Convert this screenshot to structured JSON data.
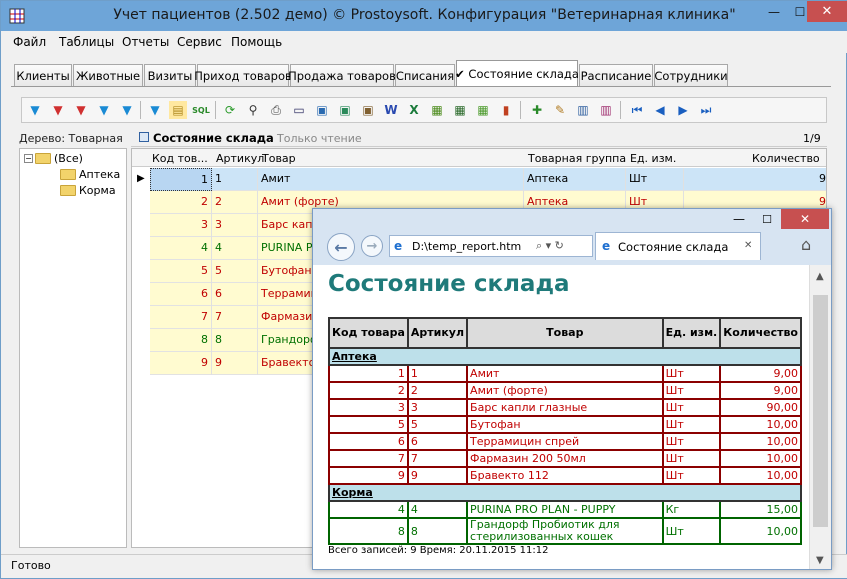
{
  "window": {
    "title": "Учет пациентов (2.502 демо) © Prostoysoft. Конфигурация \"Ветеринарная клиника\"",
    "min_glyph": "—",
    "max_glyph": "☐",
    "close_glyph": "✕"
  },
  "menu": [
    "Файл",
    "Таблицы",
    "Отчеты",
    "Сервис",
    "Помощь"
  ],
  "tabs": [
    {
      "label": "Клиенты"
    },
    {
      "label": "Животные"
    },
    {
      "label": "Визиты"
    },
    {
      "label": "Приход товаров"
    },
    {
      "label": "Продажа товаров"
    },
    {
      "label": "Списания"
    },
    {
      "label": "✔ Состояние склада",
      "active": true
    },
    {
      "label": "Расписание"
    },
    {
      "label": "Сотрудники"
    }
  ],
  "toolbar_icons": [
    "filter-icon",
    "filter-clear-icon",
    "filter-remove-icon",
    "filter-add-icon",
    "filter-edit-icon",
    "filter-view-icon",
    "tree-filter-icon",
    "sql-icon",
    "refresh-icon",
    "binoculars-icon",
    "print-icon",
    "preview-icon",
    "export-html-icon",
    "export-xml-icon",
    "export-doc-icon",
    "export-word-icon",
    "export-excel-icon",
    "export-csv-icon",
    "export-dbf-icon",
    "chart-icon",
    "add-record-icon",
    "edit-record-icon",
    "columns-icon",
    "settings-icon",
    "first-icon",
    "prev-icon",
    "next-icon",
    "last-icon"
  ],
  "tree": {
    "label": "Дерево: Товарная",
    "root": "(Все)",
    "children": [
      "Аптека",
      "Корма"
    ]
  },
  "grid": {
    "title": "Состояние склада",
    "mode": "Только чтение",
    "counter": "1/9",
    "columns": [
      "Код тов...",
      "Артикул",
      "Товар",
      "Товарная группа",
      "Ед. изм.",
      "Количество"
    ],
    "rows": [
      {
        "code": "1",
        "art": "1",
        "name": "Амит",
        "group": "Аптека",
        "unit": "Шт",
        "qty": "9",
        "color": "sel"
      },
      {
        "code": "2",
        "art": "2",
        "name": "Амит (форте)",
        "group": "Аптека",
        "unit": "Шт",
        "qty": "9",
        "color": "red"
      },
      {
        "code": "3",
        "art": "3",
        "name": "Барс капли",
        "group": "",
        "unit": "",
        "qty": "",
        "color": "red"
      },
      {
        "code": "4",
        "art": "4",
        "name": "PURINA PR",
        "group": "",
        "unit": "",
        "qty": "",
        "color": "green"
      },
      {
        "code": "5",
        "art": "5",
        "name": "Бутофан",
        "group": "",
        "unit": "",
        "qty": "",
        "color": "red"
      },
      {
        "code": "6",
        "art": "6",
        "name": "Террамици",
        "group": "",
        "unit": "",
        "qty": "",
        "color": "red"
      },
      {
        "code": "7",
        "art": "7",
        "name": "Фармазин",
        "group": "",
        "unit": "",
        "qty": "",
        "color": "red"
      },
      {
        "code": "8",
        "art": "8",
        "name": "Грандорф",
        "group": "",
        "unit": "",
        "qty": "",
        "color": "green"
      },
      {
        "code": "9",
        "art": "9",
        "name": "Бравекто",
        "group": "",
        "unit": "",
        "qty": "",
        "color": "red"
      }
    ]
  },
  "status": "Готово",
  "browser": {
    "address": "D:\\temp_report.htm",
    "search_glyph": "⌕ ▾ ↻",
    "tab_title": "Состояние склада",
    "tab_close": "✕",
    "home_glyph": "⌂",
    "back_glyph": "←",
    "forward_glyph": "→",
    "min_glyph": "—",
    "max_glyph": "☐",
    "close_glyph": "✕"
  },
  "report": {
    "title": "Состояние склада",
    "headers": [
      "Код товара",
      "Артикул",
      "Товар",
      "Ед. изм.",
      "Количество"
    ],
    "groups": [
      {
        "name": "Аптека",
        "color": "red",
        "rows": [
          {
            "code": "1",
            "art": "1",
            "name": "Амит",
            "unit": "Шт",
            "qty": "9,00"
          },
          {
            "code": "2",
            "art": "2",
            "name": "Амит (форте)",
            "unit": "Шт",
            "qty": "9,00"
          },
          {
            "code": "3",
            "art": "3",
            "name": "Барс капли глазные",
            "unit": "Шт",
            "qty": "90,00"
          },
          {
            "code": "5",
            "art": "5",
            "name": "Бутофан",
            "unit": "Шт",
            "qty": "10,00"
          },
          {
            "code": "6",
            "art": "6",
            "name": "Террамицин спрей",
            "unit": "Шт",
            "qty": "10,00"
          },
          {
            "code": "7",
            "art": "7",
            "name": "Фармазин 200 50мл",
            "unit": "Шт",
            "qty": "10,00"
          },
          {
            "code": "9",
            "art": "9",
            "name": "Бравекто 112",
            "unit": "Шт",
            "qty": "10,00"
          }
        ]
      },
      {
        "name": "Корма",
        "color": "green",
        "rows": [
          {
            "code": "4",
            "art": "4",
            "name": "PURINA PRO PLAN - PUPPY",
            "unit": "Кг",
            "qty": "15,00"
          },
          {
            "code": "8",
            "art": "8",
            "name": "Грандорф Пробиотик для стерилизованных кошек",
            "unit": "Шт",
            "qty": "10,00"
          }
        ]
      }
    ],
    "footer": "Всего записей: 9    Время: 20.11.2015 11:12"
  },
  "colors": {
    "red_text": "#c00000",
    "green_text": "#007000",
    "selected_row": "#cce4f7",
    "odd_row": "#fffbd0"
  }
}
